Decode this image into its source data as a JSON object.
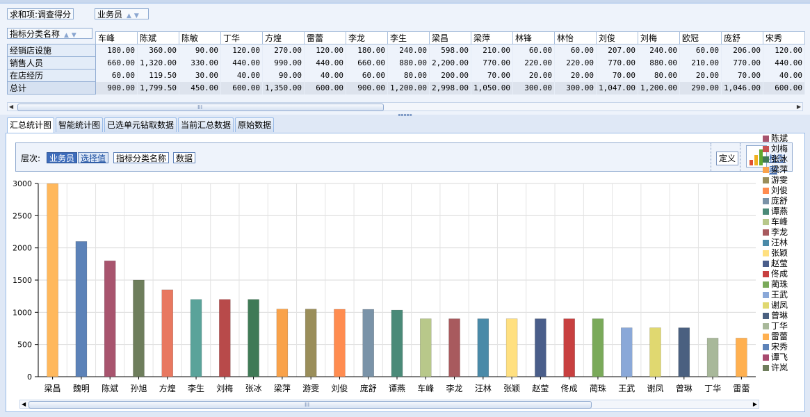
{
  "pivot": {
    "data_field": "求和项:调查得分",
    "column_field": "业务员",
    "row_field": "指标分类名称",
    "columns": [
      "车峰",
      "陈斌",
      "陈敏",
      "丁华",
      "方煌",
      "雷蕾",
      "李龙",
      "李生",
      "梁昌",
      "梁萍",
      "林锋",
      "林怡",
      "刘俊",
      "刘梅",
      "欧冠",
      "庞舒",
      "宋秀"
    ],
    "rows": [
      {
        "label": "经销店设施",
        "values": [
          "180.00",
          "360.00",
          "90.00",
          "120.00",
          "270.00",
          "120.00",
          "180.00",
          "240.00",
          "598.00",
          "210.00",
          "60.00",
          "60.00",
          "207.00",
          "240.00",
          "60.00",
          "206.00",
          "120.00"
        ]
      },
      {
        "label": "销售人员",
        "values": [
          "660.00",
          "1,320.00",
          "330.00",
          "440.00",
          "990.00",
          "440.00",
          "660.00",
          "880.00",
          "2,200.00",
          "770.00",
          "220.00",
          "220.00",
          "770.00",
          "880.00",
          "210.00",
          "770.00",
          "440.00"
        ]
      },
      {
        "label": "在店经历",
        "values": [
          "60.00",
          "119.50",
          "30.00",
          "40.00",
          "90.00",
          "40.00",
          "60.00",
          "80.00",
          "200.00",
          "70.00",
          "20.00",
          "20.00",
          "70.00",
          "80.00",
          "20.00",
          "70.00",
          "40.00"
        ]
      },
      {
        "label": "总计",
        "values": [
          "900.00",
          "1,799.50",
          "450.00",
          "600.00",
          "1,350.00",
          "600.00",
          "900.00",
          "1,200.00",
          "2,998.00",
          "1,050.00",
          "300.00",
          "300.00",
          "1,047.00",
          "1,200.00",
          "290.00",
          "1,046.00",
          "600.00"
        ]
      }
    ],
    "scroll_grip": "III"
  },
  "tabs": [
    {
      "label": "汇总统计图",
      "active": true
    },
    {
      "label": "智能统计图",
      "active": false
    },
    {
      "label": "已选单元钻取数据",
      "active": false
    },
    {
      "label": "当前汇总数据",
      "active": false
    },
    {
      "label": "原始数据",
      "active": false
    }
  ],
  "hierarchy": {
    "label": "层次:",
    "chips": [
      "业务员",
      "选择值",
      "指标分类名称",
      "数据"
    ],
    "define_label": "定义",
    "chart_type_label": "柱形图"
  },
  "chart_data": {
    "type": "bar",
    "categories": [
      "梁昌",
      "魏明",
      "陈斌",
      "孙旭",
      "方煌",
      "李生",
      "刘梅",
      "张冰",
      "梁萍",
      "游雯",
      "刘俊",
      "庞舒",
      "谭燕",
      "车峰",
      "李龙",
      "汪林",
      "张颖",
      "赵莹",
      "佟成",
      "蔺珠",
      "王武",
      "谢凤",
      "曾琳",
      "丁华",
      "雷蕾"
    ],
    "values": [
      2998,
      2100,
      1799.5,
      1500,
      1350,
      1200,
      1200,
      1200,
      1050,
      1050,
      1047,
      1046,
      1035,
      900,
      900,
      900,
      900,
      900,
      900,
      900,
      760,
      760,
      760,
      600,
      600
    ],
    "colors": [
      "#ffb85c",
      "#5c82b8",
      "#a8546e",
      "#6e7e5c",
      "#e87860",
      "#5aa39a",
      "#b84a4a",
      "#3f7a56",
      "#f9a24a",
      "#9a8e5a",
      "#ff8c50",
      "#7a93a8",
      "#4a8a78",
      "#b8c88a",
      "#a85a5e",
      "#4a8aa8",
      "#ffe080",
      "#4a5e8a",
      "#c84040",
      "#7aaa5a",
      "#8aa8d8",
      "#e0d870",
      "#4a6080",
      "#a8b89a",
      "#ffb050"
    ],
    "ylim": [
      0,
      3000
    ],
    "yticks": [
      0,
      500,
      1000,
      1500,
      2000,
      2500,
      3000
    ],
    "grid": true,
    "legend_position": "right",
    "legend_items": [
      {
        "name": "陈斌",
        "color": "#a8546e"
      },
      {
        "name": "刘梅",
        "color": "#c85050"
      },
      {
        "name": "张冰",
        "color": "#3f7a56"
      },
      {
        "name": "梁萍",
        "color": "#f9a24a"
      },
      {
        "name": "游雯",
        "color": "#9a8e5a"
      },
      {
        "name": "刘俊",
        "color": "#ff8c50"
      },
      {
        "name": "庞舒",
        "color": "#7a93a8"
      },
      {
        "name": "谭燕",
        "color": "#4a8a78"
      },
      {
        "name": "车峰",
        "color": "#b8c88a"
      },
      {
        "name": "李龙",
        "color": "#a85a5e"
      },
      {
        "name": "汪林",
        "color": "#4a8aa8"
      },
      {
        "name": "张颖",
        "color": "#ffe080"
      },
      {
        "name": "赵莹",
        "color": "#4a5e8a"
      },
      {
        "name": "佟成",
        "color": "#c84040"
      },
      {
        "name": "蔺珠",
        "color": "#7aaa5a"
      },
      {
        "name": "王武",
        "color": "#8aa8d8"
      },
      {
        "name": "谢凤",
        "color": "#e0d870"
      },
      {
        "name": "曾琳",
        "color": "#4a6080"
      },
      {
        "name": "丁华",
        "color": "#a8b89a"
      },
      {
        "name": "雷蕾",
        "color": "#ffb050"
      },
      {
        "name": "宋秀",
        "color": "#5c82b8"
      },
      {
        "name": "谭飞",
        "color": "#a84a6e"
      },
      {
        "name": "许岚",
        "color": "#6e7e5c"
      }
    ]
  }
}
